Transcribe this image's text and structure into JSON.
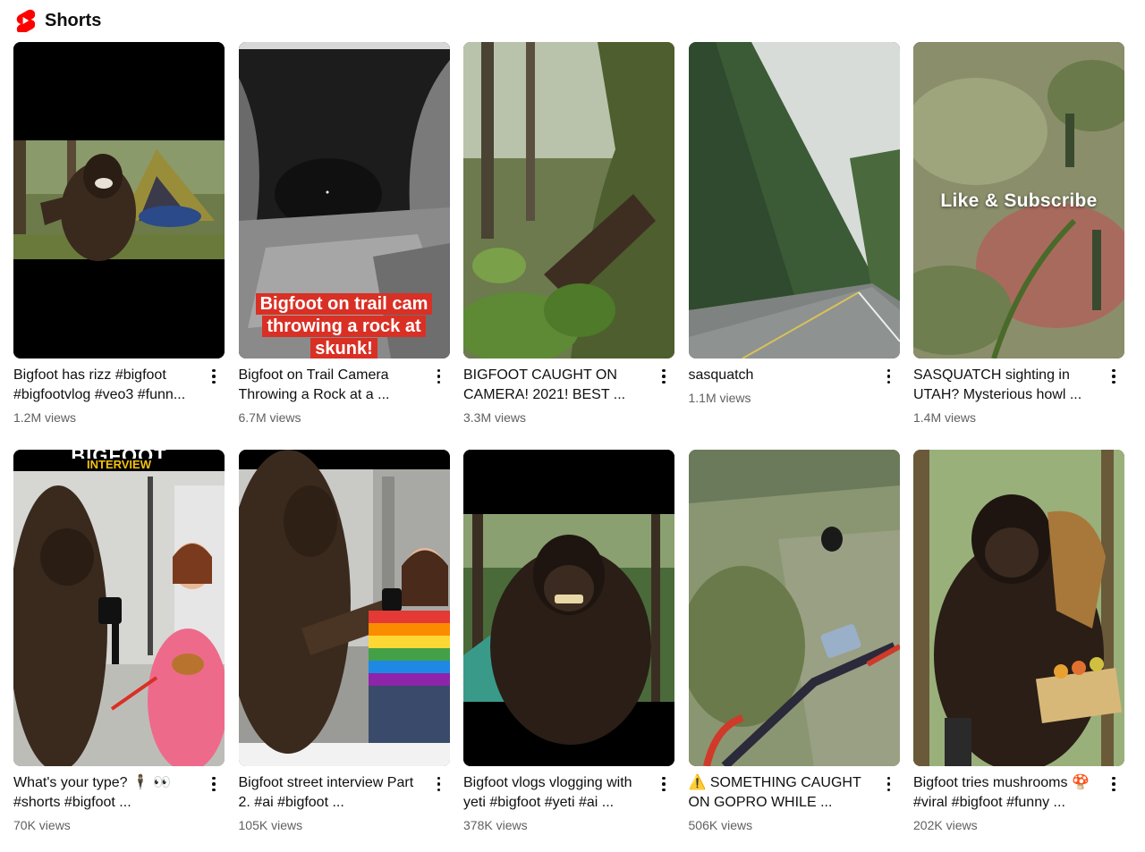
{
  "shelf": {
    "title": "Shorts",
    "logo_icon": "youtube-shorts-logo",
    "accent": "#ff0000"
  },
  "shorts": [
    {
      "title": "Bigfoot has rizz #bigfoot #bigfootvlog #veo3 #funn...",
      "views": "1.2M views",
      "overlay": ""
    },
    {
      "title": "Bigfoot on Trail Camera Throwing a Rock at a ...",
      "views": "6.7M views",
      "overlay": "Bigfoot on trail cam throwing a rock at skunk!"
    },
    {
      "title": "BIGFOOT CAUGHT ON CAMERA! 2021! BEST ...",
      "views": "3.3M views",
      "overlay": ""
    },
    {
      "title": "sasquatch",
      "views": "1.1M views",
      "overlay": ""
    },
    {
      "title": "SASQUATCH sighting in UTAH? Mysterious howl ...",
      "views": "1.4M views",
      "overlay": "Like & Subscribe"
    },
    {
      "title": "What's your type? 🕴 👀 #shorts #bigfoot ...",
      "views": "70K views",
      "overlay": "INTERVIEW",
      "overlay_top": "BIGFOOT"
    },
    {
      "title": "Bigfoot street interview Part 2. #ai #bigfoot ...",
      "views": "105K views",
      "overlay": ""
    },
    {
      "title": "Bigfoot vlogs vlogging with yeti #bigfoot #yeti #ai ...",
      "views": "378K views",
      "overlay": ""
    },
    {
      "title": "⚠️ SOMETHING CAUGHT ON GOPRO WHILE ...",
      "views": "506K views",
      "overlay": ""
    },
    {
      "title": "Bigfoot tries mushrooms 🍄 #viral #bigfoot #funny ...",
      "views": "202K views",
      "overlay": ""
    }
  ],
  "icons": {
    "more": "more-vert-icon"
  }
}
